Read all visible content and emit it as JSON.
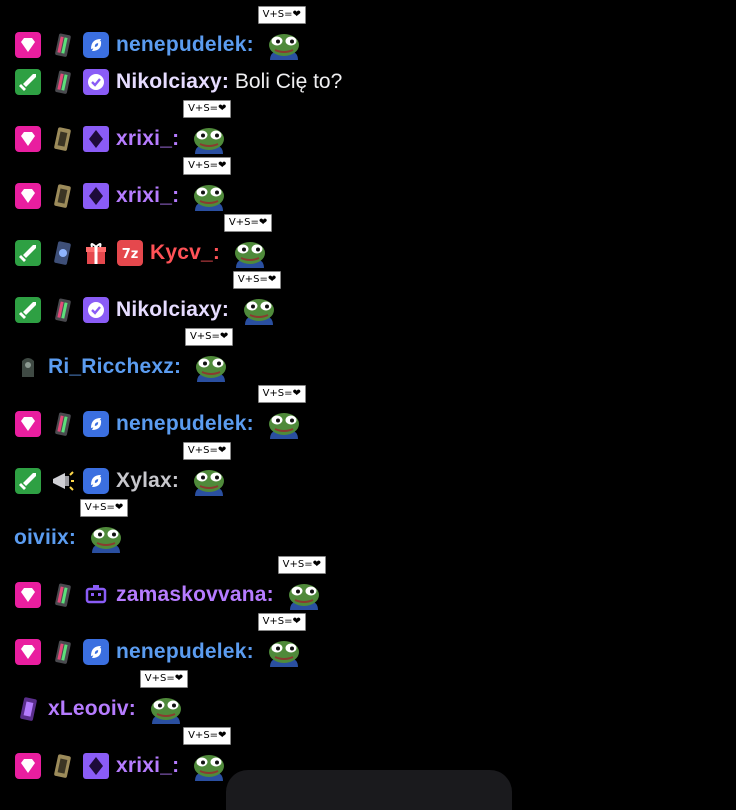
{
  "colors": {
    "background": "#000000",
    "message_text": "#efeff1",
    "sub_pink": "#e91e9f",
    "mod_green": "#2ea043",
    "partner_purple": "#8a5cf6",
    "user_blue": "#5b9cf0",
    "user_purple": "#b67cff",
    "user_white_purple": "#e6dcff",
    "user_red": "#ff5257",
    "user_gray": "#c7c7cc"
  },
  "messages": [
    {
      "user": "nenepudelek",
      "color": "#5b9cf0",
      "badges": [
        "sub-gem",
        "bits-can",
        "prime"
      ],
      "text": "",
      "emote": true,
      "emote_sign": "V+S=❤"
    },
    {
      "user": "Nikolciaxy",
      "color": "#e6dcff",
      "badges": [
        "mod-sword",
        "bits-can",
        "verified"
      ],
      "text": "Boli Cię to?",
      "emote": false,
      "emote_sign": ""
    },
    {
      "user": "xrixi_",
      "color": "#b67cff",
      "badges": [
        "sub-gem",
        "gold-can",
        "vip-diamond"
      ],
      "text": "",
      "emote": true,
      "emote_sign": "V+S=❤"
    },
    {
      "user": "xrixi_",
      "color": "#b67cff",
      "badges": [
        "sub-gem",
        "gold-can",
        "vip-diamond"
      ],
      "text": "",
      "emote": true,
      "emote_sign": "V+S=❤"
    },
    {
      "user": "Kycv_",
      "color": "#ff5257",
      "badges": [
        "mod-sword",
        "blue-can",
        "gift",
        "turbo"
      ],
      "text": "",
      "emote": true,
      "emote_sign": "V+S=❤"
    },
    {
      "user": "Nikolciaxy",
      "color": "#e6dcff",
      "badges": [
        "mod-sword",
        "bits-can",
        "verified"
      ],
      "text": "",
      "emote": true,
      "emote_sign": "V+S=❤"
    },
    {
      "user": "Ri_Ricchexz",
      "color": "#5b9cf0",
      "badges": [
        "dark-can"
      ],
      "text": "",
      "emote": true,
      "emote_sign": "V+S=❤"
    },
    {
      "user": "nenepudelek",
      "color": "#5b9cf0",
      "badges": [
        "sub-gem",
        "bits-can",
        "prime"
      ],
      "text": "",
      "emote": true,
      "emote_sign": "V+S=❤"
    },
    {
      "user": "Xylax",
      "color": "#c7c7cc",
      "badges": [
        "mod-sword",
        "horn",
        "prime"
      ],
      "text": "",
      "emote": true,
      "emote_sign": "V+S=❤"
    },
    {
      "user": "oiviix",
      "color": "#5b9cf0",
      "badges": [],
      "text": "",
      "emote": true,
      "emote_sign": "V+S=❤"
    },
    {
      "user": "zamaskovvana",
      "color": "#b67cff",
      "badges": [
        "sub-gem",
        "bits-can",
        "robot"
      ],
      "text": "",
      "emote": true,
      "emote_sign": "V+S=❤"
    },
    {
      "user": "nenepudelek",
      "color": "#5b9cf0",
      "badges": [
        "sub-gem",
        "bits-can",
        "prime"
      ],
      "text": "",
      "emote": true,
      "emote_sign": "V+S=❤"
    },
    {
      "user": "xLeooiv",
      "color": "#b67cff",
      "badges": [
        "purple-can"
      ],
      "text": "",
      "emote": true,
      "emote_sign": "V+S=❤"
    },
    {
      "user": "xrixi_",
      "color": "#b67cff",
      "badges": [
        "sub-gem",
        "gold-can",
        "vip-diamond"
      ],
      "text": "",
      "emote": true,
      "emote_sign": "V+S=❤"
    }
  ]
}
